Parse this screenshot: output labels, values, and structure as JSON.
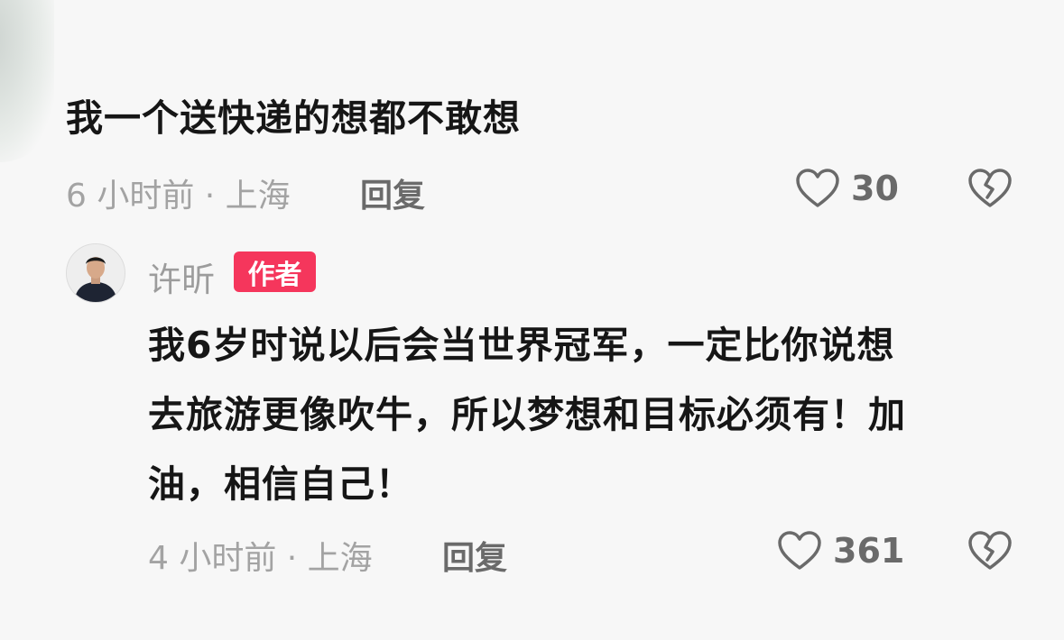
{
  "comment": {
    "text": "我一个送快递的想都不敢想",
    "meta": "6 小时前 · 上海",
    "reply_label": "回复",
    "like_count": "30"
  },
  "reply": {
    "author": "许昕",
    "badge": "作者",
    "lines": [
      "我6岁时说以后会当世界冠军，一定比你说想",
      "去旅游更像吹牛，所以梦想和目标必须有！加",
      "油，相信自己！"
    ],
    "meta": "4 小时前 · 上海",
    "reply_label": "回复",
    "like_count": "361"
  },
  "colors": {
    "background": "#f7f7f7",
    "badge": "#f5365c",
    "meta_text": "#a3a3a3",
    "action_text": "#6a6a6a"
  },
  "icons": {
    "like": "heart-outline-icon",
    "dislike": "broken-heart-icon",
    "avatar": "user-avatar"
  }
}
